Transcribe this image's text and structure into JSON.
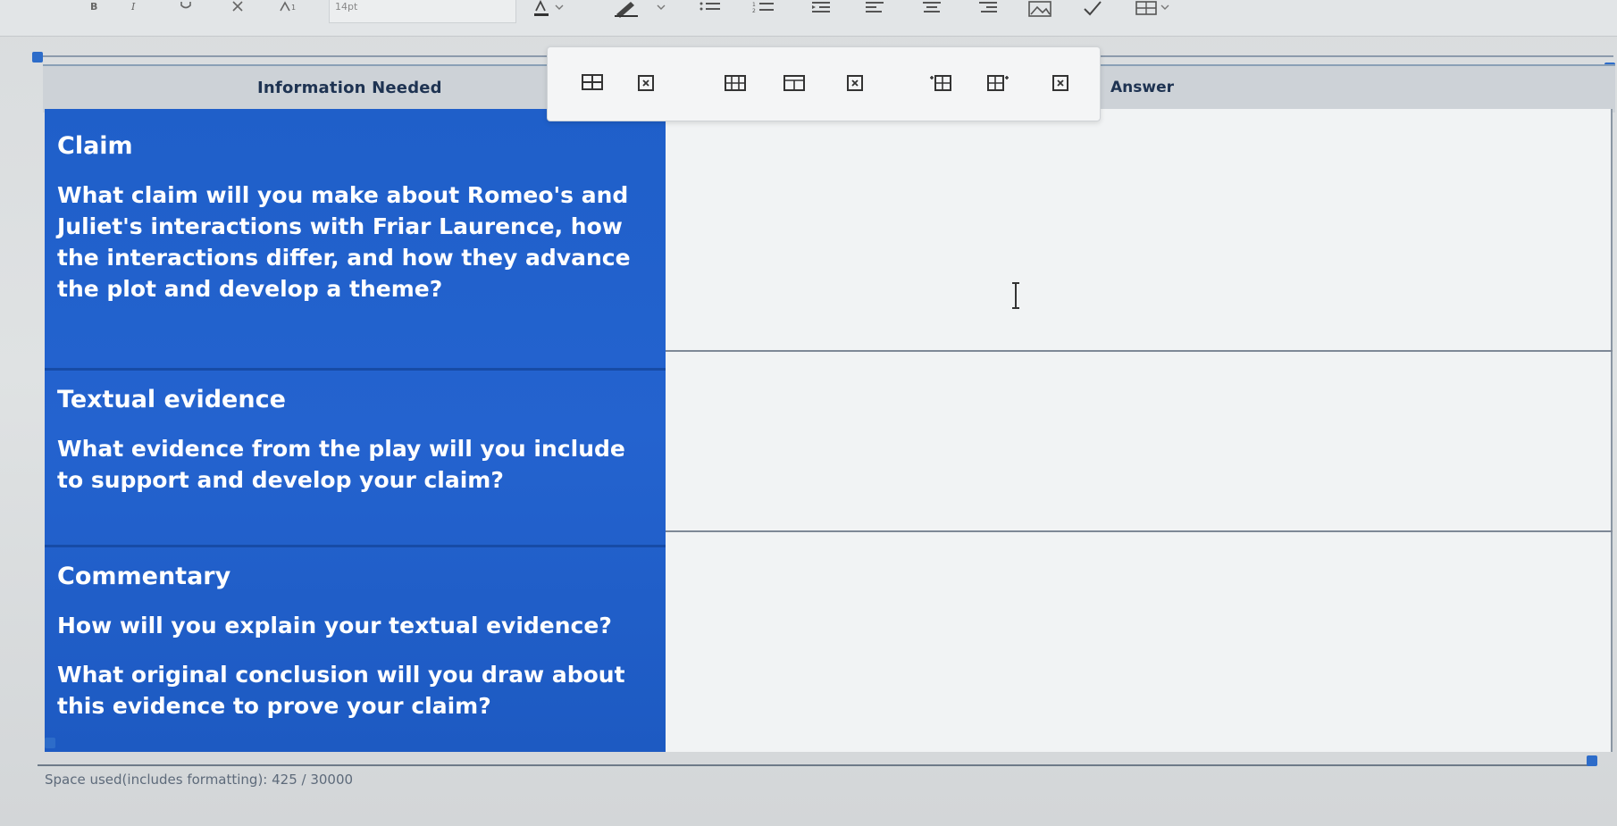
{
  "toolbar": {
    "font_size_value": "14pt",
    "buttons": [
      "bold-icon",
      "italic-icon",
      "underline-icon",
      "strikethrough-icon",
      "superscript-icon",
      "text-color-icon",
      "highlight-icon",
      "bulleted-list-icon",
      "numbered-list-icon",
      "indent-icon",
      "align-left-icon",
      "align-center-icon",
      "align-right-icon",
      "image-icon",
      "special-char-icon",
      "table-icon"
    ]
  },
  "table_toolbar": {
    "buttons": [
      "table-properties-icon",
      "delete-table-icon",
      "insert-row-before-icon",
      "insert-row-after-icon",
      "delete-row-icon",
      "insert-col-before-icon",
      "insert-col-after-icon",
      "delete-col-icon"
    ]
  },
  "table": {
    "header_info": "Information Needed",
    "header_answer": "Answer",
    "rows": [
      {
        "title": "Claim",
        "questions": [
          "What claim will you make about Romeo's and Juliet's interactions with Friar Laurence, how the interactions differ, and how they advance the plot and develop a theme?"
        ]
      },
      {
        "title": "Textual evidence",
        "questions": [
          "What evidence from the play will you include to support and develop your claim?"
        ]
      },
      {
        "title": "Commentary",
        "questions": [
          "How will you explain your textual evidence?",
          "What original conclusion will you draw about this evidence to prove your claim?"
        ]
      }
    ]
  },
  "status": {
    "space_used": "Space used(includes formatting): 425 / 30000"
  },
  "colors": {
    "cell_blue": "#2463cf",
    "answer_bg": "#f1f3f4",
    "header_bg": "#cdd2d7"
  }
}
